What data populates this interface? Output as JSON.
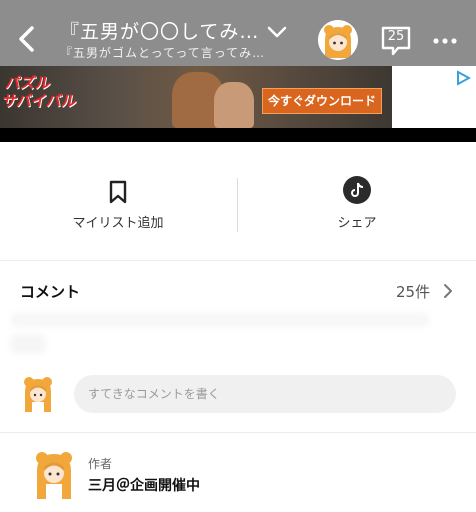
{
  "header": {
    "title": "『五男が〇〇してみ…",
    "subtitle": "『五男がゴムとってって言ってみ…",
    "comment_count": "25"
  },
  "ad": {
    "logo_line1": "パズル",
    "logo_line2": "サバイバル",
    "button_label": "今すぐダウンロード"
  },
  "actions": {
    "mylist_label": "マイリスト追加",
    "share_label": "シェア"
  },
  "comments": {
    "title": "コメント",
    "total": "25件",
    "placeholder": "すてきなコメントを書く"
  },
  "author": {
    "role": "作者",
    "name": "三月＠企画開催中"
  },
  "colors": {
    "header_bg": "#8d8d8d",
    "ad_button": "#d9651e",
    "avatar_hood": "#f2a73b"
  }
}
